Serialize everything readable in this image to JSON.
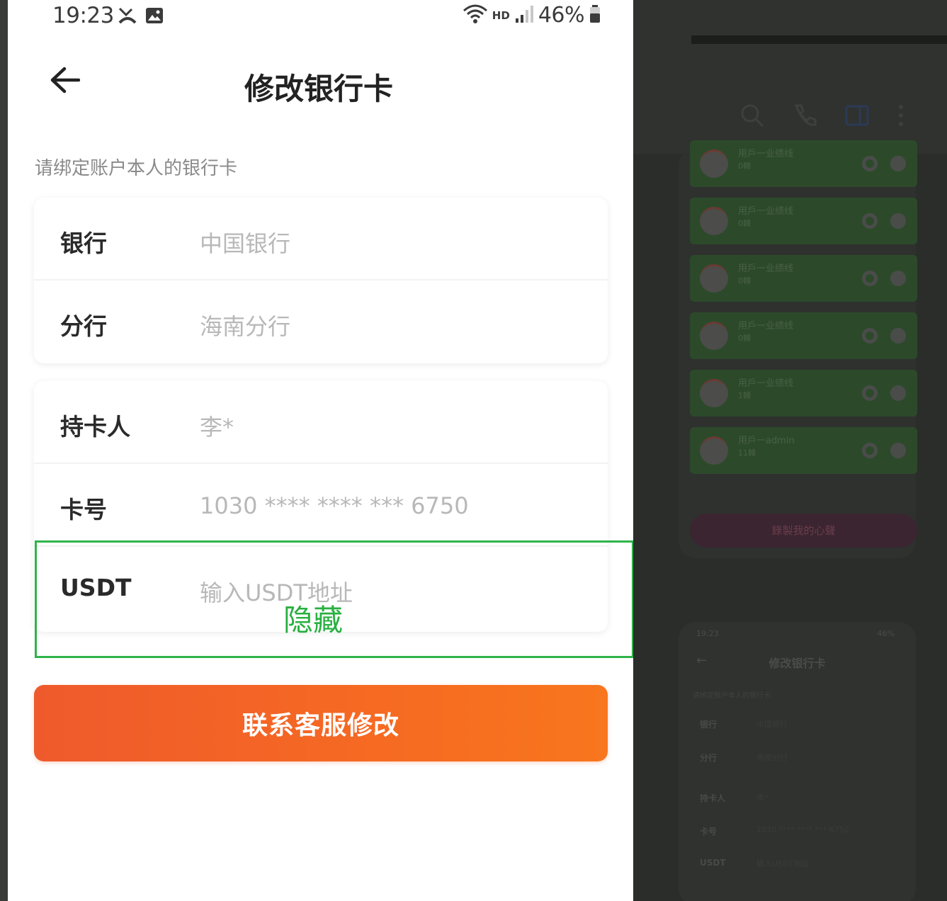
{
  "status": {
    "time": "19:23",
    "hd": "HD",
    "battery": "46%"
  },
  "nav": {
    "back_icon": "arrow-left-icon",
    "title": "修改银行卡"
  },
  "hint": "请绑定账户本人的银行卡",
  "card1": [
    {
      "label": "银行",
      "value": "中国银行"
    },
    {
      "label": "分行",
      "value": "海南分行"
    }
  ],
  "card2": [
    {
      "label": "持卡人",
      "value": "李*"
    },
    {
      "label": "卡号",
      "value": "1030 **** **** *** 6750"
    },
    {
      "label": "USDT",
      "placeholder": "输入USDT地址"
    }
  ],
  "annotation": {
    "text": "隐藏",
    "color": "#2fb34a"
  },
  "submit_label": "联系客服修改",
  "colors": {
    "accent": "#f26a22",
    "label": "#2a2a2a",
    "value": "#b8b8b8"
  },
  "background": {
    "list": [
      {
        "name": "用戶一业绩线",
        "sub": "0韓"
      },
      {
        "name": "用戶一业绩线",
        "sub": "0韓"
      },
      {
        "name": "用戶一业绩线",
        "sub": "0韓"
      },
      {
        "name": "用戶一业绩线",
        "sub": "0韓"
      },
      {
        "name": "用戶一业绩线",
        "sub": "1韓"
      },
      {
        "name": "用戶一admin",
        "sub": "11韓"
      }
    ],
    "pill": "錄製我的心聲",
    "mini": {
      "status_time": "19:23",
      "status_right": "46%",
      "title": "修改银行卡",
      "hint": "请绑定账户本人的银行卡",
      "rows": [
        {
          "label": "银行",
          "value": "中国银行"
        },
        {
          "label": "分行",
          "value": "海南分行"
        },
        {
          "label": "持卡人",
          "value": "李*"
        },
        {
          "label": "卡号",
          "value": "1030 **** **** *** 6750"
        },
        {
          "label": "USDT",
          "value": "输入USDT地址"
        }
      ]
    }
  }
}
